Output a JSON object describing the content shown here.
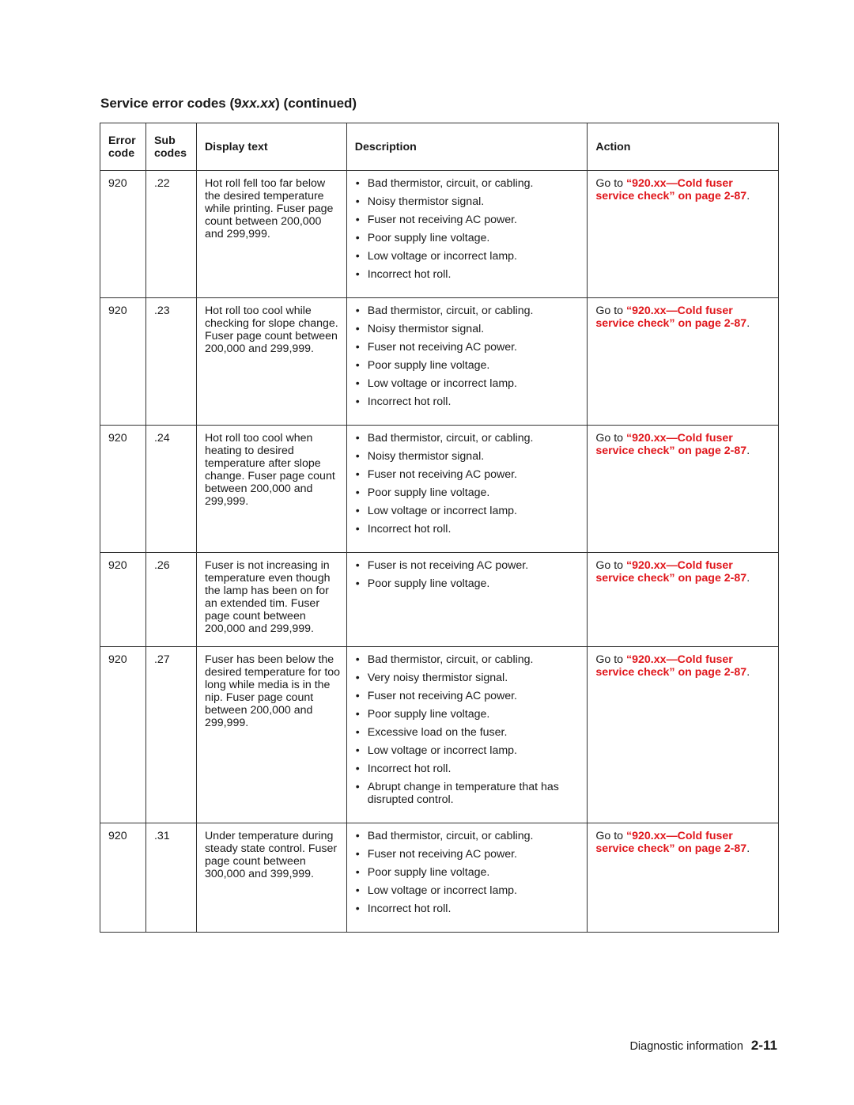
{
  "title": {
    "prefix": "Service error codes (9",
    "italic": "xx.xx",
    "suffix": ") (continued)"
  },
  "table": {
    "headers": {
      "error_code": "Error code",
      "sub_codes": "Sub codes",
      "display_text": "Display text",
      "description": "Description",
      "action": "Action"
    },
    "rows": [
      {
        "code": "920",
        "sub": ".22",
        "display": "Hot roll fell too far below the desired temperature while printing. Fuser page count between 200,000 and 299,999.",
        "desc": [
          "Bad thermistor, circuit, or cabling.",
          "Noisy thermistor signal.",
          "Fuser not receiving AC power.",
          "Poor supply line voltage.",
          "Low voltage or incorrect lamp.",
          "Incorrect hot roll."
        ],
        "action": {
          "pre": "Go to ",
          "link": "“920.xx—Cold fuser service check” on page 2-87",
          "post": "."
        }
      },
      {
        "code": "920",
        "sub": ".23",
        "display": "Hot roll too cool while checking for slope change. Fuser page count between 200,000 and 299,999.",
        "desc": [
          "Bad thermistor, circuit, or cabling.",
          "Noisy thermistor signal.",
          "Fuser not receiving AC power.",
          "Poor supply line voltage.",
          "Low voltage or incorrect lamp.",
          "Incorrect hot roll."
        ],
        "action": {
          "pre": "Go to ",
          "link": "“920.xx—Cold fuser service check” on page 2-87",
          "post": "."
        }
      },
      {
        "code": "920",
        "sub": ".24",
        "display": "Hot roll too cool when heating to desired temperature after slope change. Fuser page count between 200,000 and 299,999.",
        "desc": [
          "Bad thermistor, circuit, or cabling.",
          "Noisy thermistor signal.",
          "Fuser not receiving AC power.",
          "Poor supply line voltage.",
          "Low voltage or incorrect lamp.",
          "Incorrect hot roll."
        ],
        "action": {
          "pre": "Go to ",
          "link": "“920.xx—Cold fuser service check” on page 2-87",
          "post": "."
        }
      },
      {
        "code": "920",
        "sub": ".26",
        "display": "Fuser is not increasing in temperature even though the lamp has been on for an extended tim. Fuser page count between 200,000 and 299,999.",
        "desc": [
          "Fuser is not receiving AC power.",
          "Poor supply line voltage."
        ],
        "action": {
          "pre": "Go to ",
          "link": "“920.xx—Cold fuser service check” on page 2-87",
          "post": "."
        }
      },
      {
        "code": "920",
        "sub": ".27",
        "display": "Fuser has been below the desired temperature for too long while media is in the nip. Fuser page count between 200,000 and 299,999.",
        "desc": [
          "Bad thermistor, circuit, or cabling.",
          "Very noisy thermistor signal.",
          "Fuser not receiving AC power.",
          "Poor supply line voltage.",
          "Excessive load on the fuser.",
          "Low voltage or incorrect lamp.",
          "Incorrect hot roll.",
          "Abrupt change in temperature that has disrupted control."
        ],
        "action": {
          "pre": "Go to ",
          "link": "“920.xx—Cold fuser service check” on page 2-87",
          "post": "."
        }
      },
      {
        "code": "920",
        "sub": ".31",
        "display": "Under temperature during steady state control. Fuser page count between 300,000 and 399,999.",
        "desc": [
          "Bad thermistor, circuit, or cabling.",
          "Fuser not receiving AC power.",
          "Poor supply line voltage.",
          "Low voltage or incorrect lamp.",
          "Incorrect hot roll."
        ],
        "action": {
          "pre": "Go to ",
          "link": "“920.xx—Cold fuser service check” on page 2-87",
          "post": "."
        }
      }
    ]
  },
  "footer": {
    "section": "Diagnostic information",
    "page": "2-11"
  },
  "colors": {
    "link": "#e0161b",
    "text": "#1a1a1a"
  }
}
